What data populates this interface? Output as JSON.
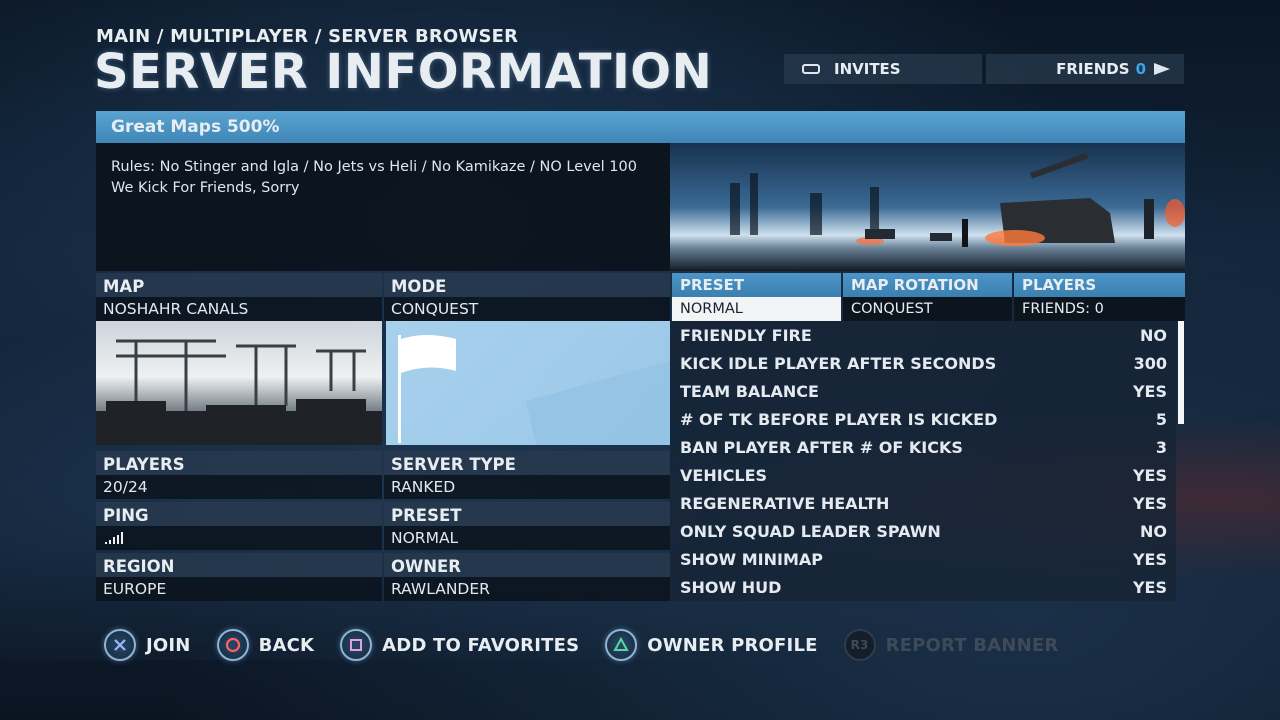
{
  "header": {
    "breadcrumb": "MAIN / MULTIPLAYER / SERVER BROWSER",
    "title": "SERVER INFORMATION",
    "invites_label": "INVITES",
    "friends_label": "FRIENDS",
    "friends_count": "0"
  },
  "server": {
    "name": "Great Maps 500%",
    "description_line1": "Rules: No Stinger and Igla / No Jets vs Heli / No Kamikaze / NO Level 100",
    "description_line2": "We Kick For Friends, Sorry"
  },
  "details": {
    "map_label": "MAP",
    "map_value": "NOSHAHR CANALS",
    "mode_label": "MODE",
    "mode_value": "CONQUEST",
    "players_label": "PLAYERS",
    "players_value": "20/24",
    "server_type_label": "SERVER TYPE",
    "server_type_value": "RANKED",
    "ping_label": "PING",
    "ping_level": 5,
    "preset_label": "PRESET",
    "preset_value": "NORMAL",
    "region_label": "REGION",
    "region_value": "EUROPE",
    "owner_label": "OWNER",
    "owner_value": "RAWLANDER"
  },
  "tabs": [
    {
      "label": "PRESET",
      "value": "NORMAL"
    },
    {
      "label": "MAP ROTATION",
      "value": "CONQUEST"
    },
    {
      "label": "PLAYERS",
      "value": "FRIENDS: 0"
    }
  ],
  "settings": [
    {
      "name": "FRIENDLY FIRE",
      "value": "NO"
    },
    {
      "name": "KICK IDLE PLAYER AFTER SECONDS",
      "value": "300"
    },
    {
      "name": "TEAM BALANCE",
      "value": "YES"
    },
    {
      "name": "# OF TK BEFORE PLAYER IS KICKED",
      "value": "5"
    },
    {
      "name": "BAN PLAYER AFTER # OF KICKS",
      "value": "3"
    },
    {
      "name": "VEHICLES",
      "value": "YES"
    },
    {
      "name": "REGENERATIVE HEALTH",
      "value": "YES"
    },
    {
      "name": "ONLY SQUAD LEADER SPAWN",
      "value": "NO"
    },
    {
      "name": "SHOW MINIMAP",
      "value": "YES"
    },
    {
      "name": "SHOW HUD",
      "value": "YES"
    }
  ],
  "footer": {
    "join": "JOIN",
    "back": "BACK",
    "favorites": "ADD TO FAVORITES",
    "owner_profile": "OWNER PROFILE",
    "report_banner": "REPORT BANNER",
    "r3_glyph": "R3"
  },
  "colors": {
    "accent_blue": "#3f86b6",
    "friends_count": "#35a7e8",
    "cross": "#9ab8ff",
    "circle": "#ff5f6b",
    "square": "#e29ee8",
    "triangle": "#58d6a6"
  }
}
